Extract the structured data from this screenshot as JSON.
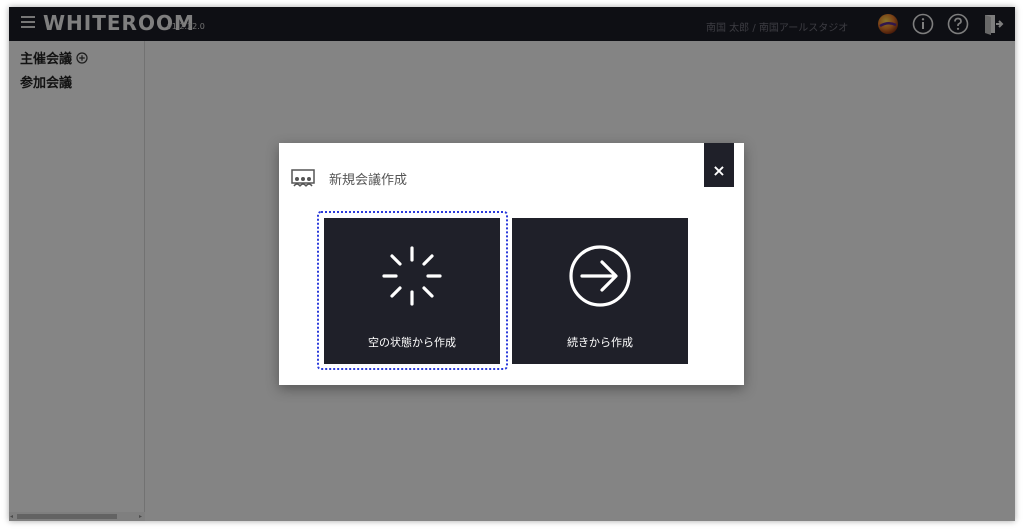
{
  "app": {
    "logo": "WHITEROOM",
    "version": "v1.2.22.0",
    "user_info": "南国 太郎 / 南国アールスタジオ"
  },
  "sidebar": {
    "items": [
      {
        "label": "主催会議"
      },
      {
        "label": "参加会議"
      }
    ]
  },
  "dialog": {
    "title": "新規会議作成",
    "close_label": "×",
    "options": [
      {
        "label": "空の状態から作成",
        "icon": "loading-spinner-icon"
      },
      {
        "label": "続きから作成",
        "icon": "arrow-right-circle-icon"
      }
    ]
  },
  "colors": {
    "topbar": "#1b1c26",
    "dark_tile": "#1f2029",
    "focus": "#2b3bdb"
  }
}
